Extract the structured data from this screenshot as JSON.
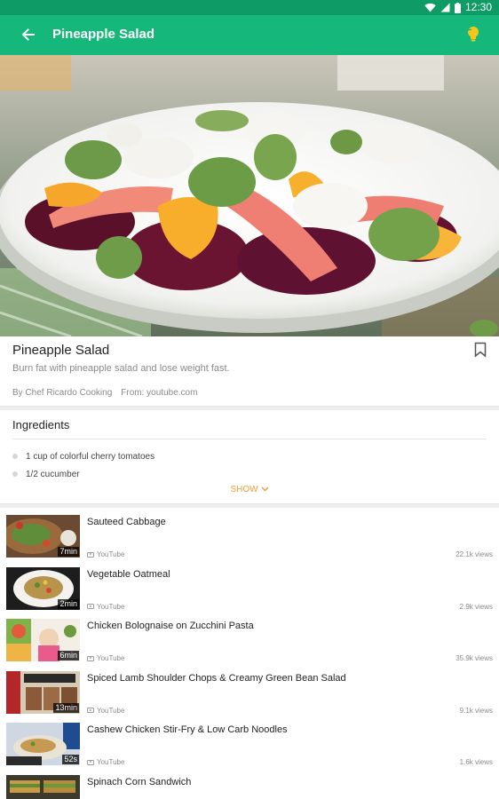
{
  "status_bar": {
    "time": "12:30",
    "icons": [
      "wifi-icon",
      "signal-icon",
      "battery-icon"
    ]
  },
  "app_bar": {
    "title": "Pineapple Salad",
    "back_icon": "arrow-left-icon",
    "action_icon": "lightbulb-icon"
  },
  "colors": {
    "primary": "#16b77a",
    "status": "#0e9b65",
    "accent": "#f29d38"
  },
  "recipe": {
    "title": "Pineapple Salad",
    "description": "Burn fat with pineapple salad and lose weight fast.",
    "author": "By Chef Ricardo Cooking",
    "source": "From: youtube.com"
  },
  "ingredients": {
    "heading": "Ingredients",
    "items": [
      "1 cup of colorful cherry tomatoes",
      "1/2 cucumber"
    ],
    "show_label": "SHOW"
  },
  "videos": [
    {
      "title": "Sauteed Cabbage",
      "duration": "7min",
      "source": "YouTube",
      "views": "22.1k views"
    },
    {
      "title": "Vegetable Oatmeal",
      "duration": "2min",
      "source": "YouTube",
      "views": "2.9k views"
    },
    {
      "title": "Chicken Bolognaise on Zucchini Pasta",
      "duration": "6min",
      "source": "YouTube",
      "views": "35.9k views"
    },
    {
      "title": "Spiced Lamb Shoulder Chops & Creamy Green Bean Salad",
      "duration": "13min",
      "source": "YouTube",
      "views": "9.1k views"
    },
    {
      "title": "Cashew Chicken Stir-Fry & Low Carb Noodles",
      "duration": "52s",
      "source": "YouTube",
      "views": "1.6k views"
    },
    {
      "title": "Spinach Corn Sandwich",
      "duration": "",
      "source": "",
      "views": ""
    }
  ]
}
